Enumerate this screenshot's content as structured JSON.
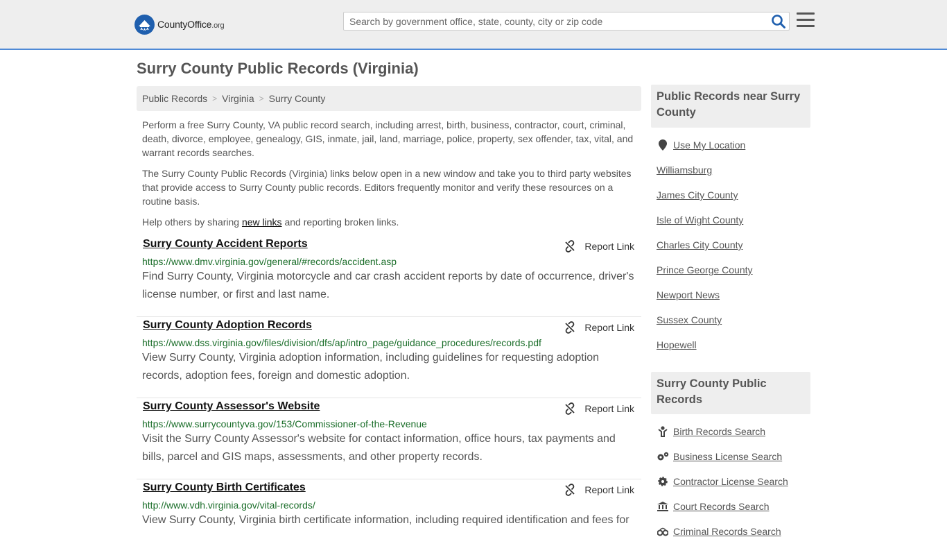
{
  "header": {
    "logo_text_main": "CountyOffice",
    "logo_text_org": ".org",
    "search_placeholder": "Search by government office, state, county, city or zip code"
  },
  "page": {
    "title": "Surry County Public Records (Virginia)"
  },
  "breadcrumb": [
    "Public Records",
    "Virginia",
    "Surry County"
  ],
  "intro": {
    "p1": "Perform a free Surry County, VA public record search, including arrest, birth, business, contractor, court, criminal, death, divorce, employee, genealogy, GIS, inmate, jail, land, marriage, police, property, sex offender, tax, vital, and warrant records searches.",
    "p2": "The Surry County Public Records (Virginia) links below open in a new window and take you to third party websites that provide access to Surry County public records. Editors frequently monitor and verify these resources on a routine basis.",
    "p3_before": "Help others by sharing ",
    "p3_link": "new links",
    "p3_after": " and reporting broken links."
  },
  "report_label": "Report Link",
  "records": [
    {
      "title": "Surry County Accident Reports",
      "url": "https://www.dmv.virginia.gov/general/#records/accident.asp",
      "desc": "Find Surry County, Virginia motorcycle and car crash accident reports by date of occurrence, driver's license number, or first and last name."
    },
    {
      "title": "Surry County Adoption Records",
      "url": "https://www.dss.virginia.gov/files/division/dfs/ap/intro_page/guidance_procedures/records.pdf",
      "desc": "View Surry County, Virginia adoption information, including guidelines for requesting adoption records, adoption fees, foreign and domestic adoption."
    },
    {
      "title": "Surry County Assessor's Website",
      "url": "https://www.surrycountyva.gov/153/Commissioner-of-the-Revenue",
      "desc": "Visit the Surry County Assessor's website for contact information, office hours, tax payments and bills, parcel and GIS maps, assessments, and other property records."
    },
    {
      "title": "Surry County Birth Certificates",
      "url": "http://www.vdh.virginia.gov/vital-records/",
      "desc": "View Surry County, Virginia birth certificate information, including required identification and fees for"
    }
  ],
  "sidebar": {
    "nearby_heading": "Public Records near Surry County",
    "use_location": "Use My Location",
    "nearby": [
      "Williamsburg",
      "James City County",
      "Isle of Wight County",
      "Charles City County",
      "Prince George County",
      "Newport News",
      "Sussex County",
      "Hopewell"
    ],
    "records_heading": "Surry County Public Records",
    "record_links": [
      {
        "label": "Birth Records Search",
        "icon": "baby-icon"
      },
      {
        "label": "Business License Search",
        "icon": "gears-icon"
      },
      {
        "label": "Contractor License Search",
        "icon": "gear-icon"
      },
      {
        "label": "Court Records Search",
        "icon": "courthouse-icon"
      },
      {
        "label": "Criminal Records Search",
        "icon": "handcuffs-icon"
      }
    ]
  },
  "colors": {
    "accent": "#1f5fae",
    "header_border": "#4f8ad6",
    "url_green": "#1b6e2a"
  }
}
